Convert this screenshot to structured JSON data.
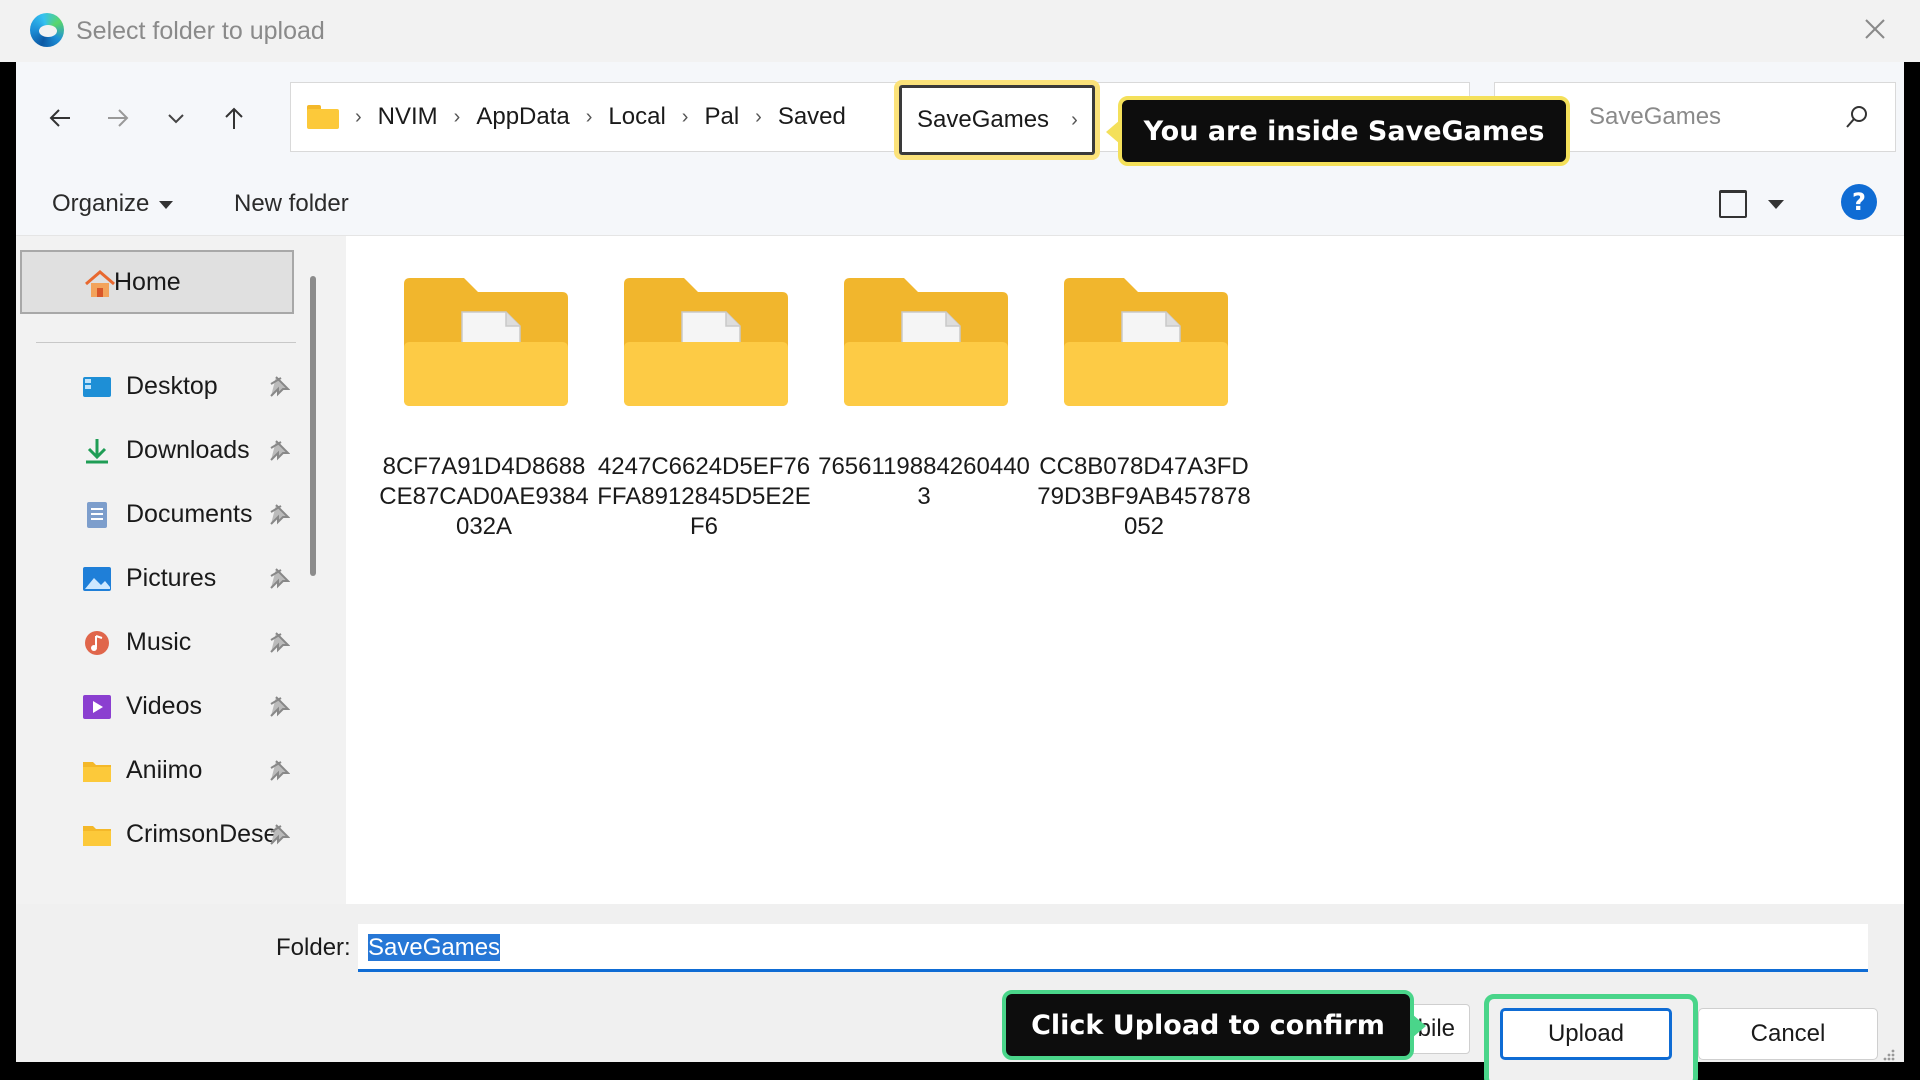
{
  "window": {
    "title": "Select folder to upload",
    "accent": "#0f6cd4"
  },
  "navigation": {
    "back_icon": "arrow-left-icon",
    "forward_icon": "arrow-right-icon",
    "recent_icon": "chevron-down-icon",
    "up_icon": "arrow-up-icon",
    "breadcrumbs": [
      "NVIM",
      "AppData",
      "Local",
      "Pal",
      "Saved"
    ],
    "current": "SaveGames",
    "search_placeholder": "SaveGames"
  },
  "annotations": {
    "address_callout": "You are inside SaveGames",
    "upload_callout": "Click Upload to confirm",
    "address_color": "#f4e05a",
    "upload_color": "#4ad58a"
  },
  "toolbar": {
    "organize": "Organize",
    "new_folder": "New folder",
    "help_label": "?"
  },
  "sidebar": {
    "home": "Home",
    "items": [
      {
        "label": "Desktop",
        "icon": "desktop-icon"
      },
      {
        "label": "Downloads",
        "icon": "download-icon"
      },
      {
        "label": "Documents",
        "icon": "document-icon"
      },
      {
        "label": "Pictures",
        "icon": "pictures-icon"
      },
      {
        "label": "Music",
        "icon": "music-icon"
      },
      {
        "label": "Videos",
        "icon": "video-icon"
      },
      {
        "label": "Aniimo",
        "icon": "folder-icon"
      },
      {
        "label": "CrimsonDese",
        "icon": "folder-icon"
      }
    ]
  },
  "content": {
    "folders": [
      {
        "name": "8CF7A91D4D8688CE87CAD0AE9384032A"
      },
      {
        "name": "4247C6624D5EF76FFA8912845D5E2EF6"
      },
      {
        "name": "76561198842604403"
      },
      {
        "name": "CC8B078D47A3FD79D3BF9AB457878052"
      }
    ]
  },
  "footer": {
    "folder_label": "Folder:",
    "folder_value": "SaveGames",
    "hidden_button_tail": "bile",
    "upload": "Upload",
    "cancel": "Cancel"
  }
}
